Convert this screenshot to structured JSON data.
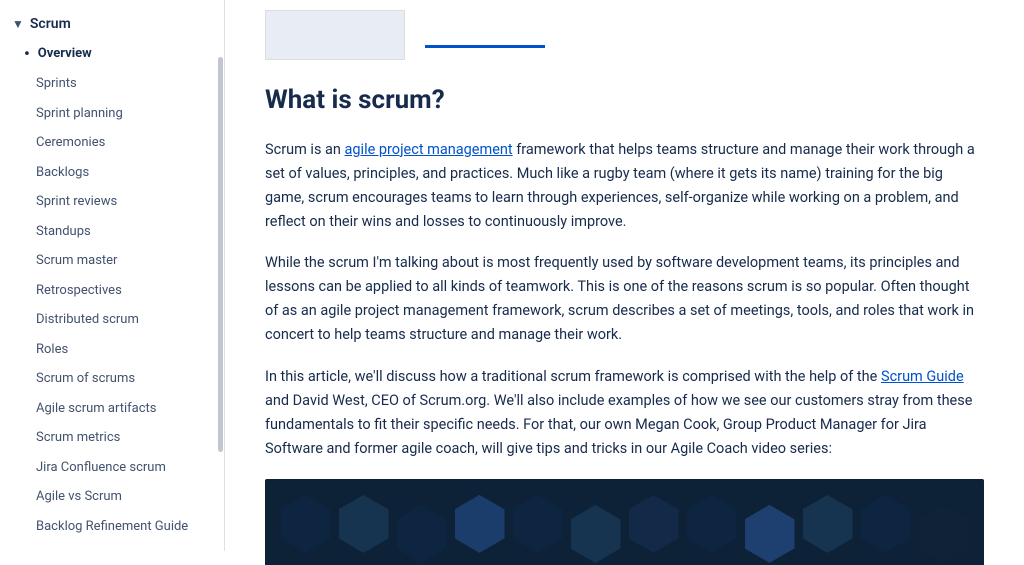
{
  "sidebar": {
    "scrum_label": "Scrum",
    "overview_label": "Overview",
    "nav_items": [
      {
        "label": "Sprints",
        "active": false
      },
      {
        "label": "Sprint planning",
        "active": false
      },
      {
        "label": "Ceremonies",
        "active": false
      },
      {
        "label": "Backlogs",
        "active": false
      },
      {
        "label": "Sprint reviews",
        "active": false
      },
      {
        "label": "Standups",
        "active": false
      },
      {
        "label": "Scrum master",
        "active": false
      },
      {
        "label": "Retrospectives",
        "active": false
      },
      {
        "label": "Distributed scrum",
        "active": false
      },
      {
        "label": "Roles",
        "active": false
      },
      {
        "label": "Scrum of scrums",
        "active": false
      },
      {
        "label": "Agile scrum artifacts",
        "active": false
      },
      {
        "label": "Scrum metrics",
        "active": false
      },
      {
        "label": "Jira Confluence scrum",
        "active": false
      },
      {
        "label": "Agile vs Scrum",
        "active": false
      },
      {
        "label": "Backlog Refinement Guide",
        "active": false
      }
    ]
  },
  "article": {
    "title": "What is scrum?",
    "paragraphs": [
      {
        "text": "Scrum is an agile project management framework that helps teams structure and manage their work through a set of values, principles, and practices. Much like a rugby team (where it gets its name) training for the big game, scrum encourages teams to learn through experiences, self-organize while working on a problem, and reflect on their wins and losses to continuously improve.",
        "link_text": "agile project management",
        "link_url": "#"
      },
      {
        "text": "While the scrum I'm talking about is most frequently used by software development teams, its principles and lessons can be applied to all kinds of teamwork. This is one of the reasons scrum is so popular. Often thought of as an agile project management framework, scrum describes a set of meetings, tools, and roles that work in concert to help teams structure and manage their work.",
        "link_text": null
      },
      {
        "text": "In this article, we'll discuss how a traditional scrum framework is comprised with the help of the Scrum Guide and David West, CEO of Scrum.org. We'll also include examples of how we see our customers stray from these fundamentals to fit their specific needs. For that, our own Megan Cook, Group Product Manager for Jira Software and former agile coach, will give tips and tricks in our Agile Coach video series:",
        "link_text": "Scrum Guide",
        "link_url": "#"
      }
    ]
  },
  "hexagons": [
    "dark",
    "medium",
    "dark",
    "light",
    "dark",
    "medium",
    "dark",
    "light",
    "dark",
    "medium",
    "dark"
  ]
}
